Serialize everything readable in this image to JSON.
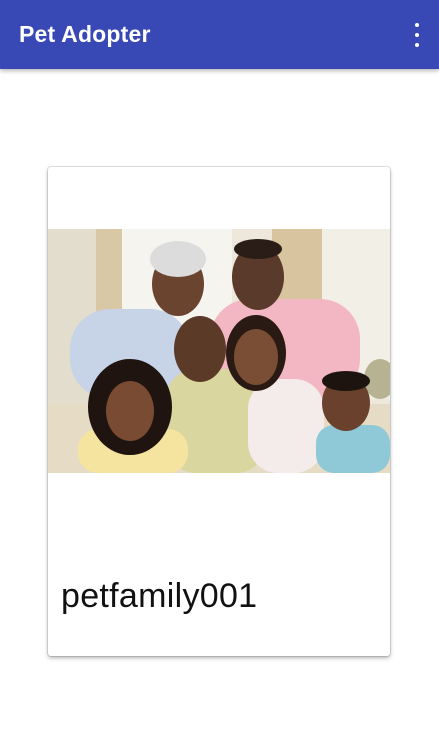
{
  "app_bar": {
    "title": "Pet Adopter",
    "background_color": "#3848b5",
    "overflow_icon": "more-vert-icon"
  },
  "card": {
    "image_name": "family-photo",
    "label": "petfamily001"
  }
}
